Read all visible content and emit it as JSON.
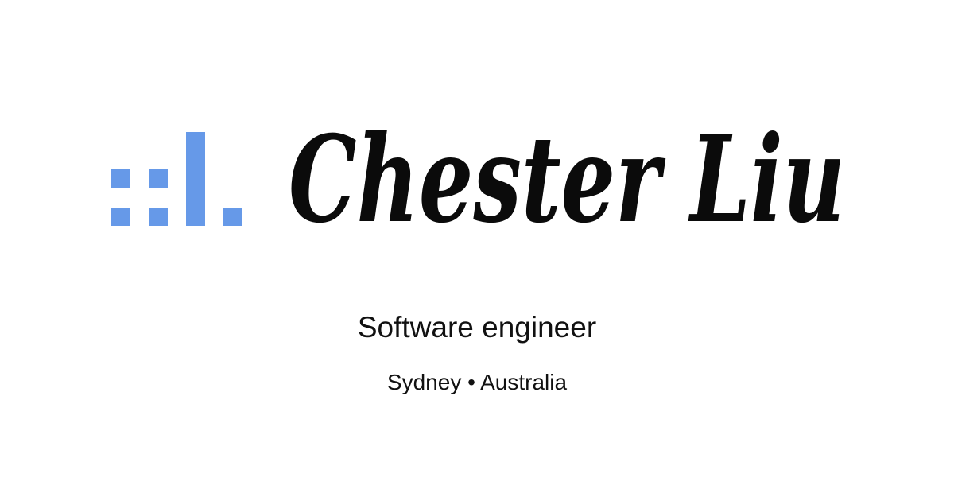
{
  "brand": {
    "logo_icon": "blue-dot-bars-logo",
    "logo_color": "#6699e8",
    "name": "Chester Liu",
    "name_color": "#0b0b0b"
  },
  "profile": {
    "title": "Software engineer",
    "location": "Sydney • Australia"
  }
}
